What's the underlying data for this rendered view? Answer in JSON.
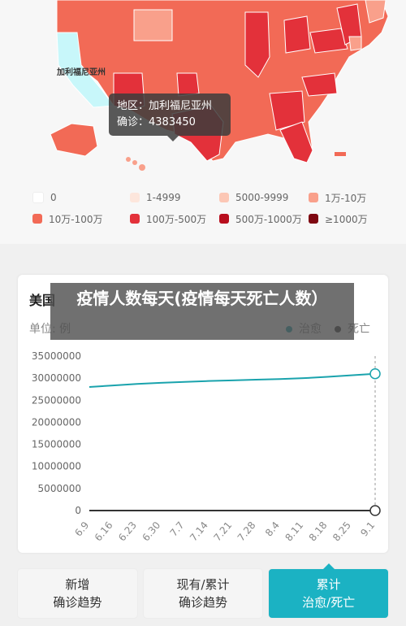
{
  "map": {
    "region_label": "加利福尼亚州",
    "tooltip": {
      "region_text": "地区：加利福尼亚州",
      "confirmed_text": "确诊：4383450"
    },
    "legend": [
      {
        "label": "0",
        "color": "#ffffff"
      },
      {
        "label": "1-4999",
        "color": "#fde6dc"
      },
      {
        "label": "5000-9999",
        "color": "#fcc7b5"
      },
      {
        "label": "1万-10万",
        "color": "#f9a08b"
      },
      {
        "label": "10万-100万",
        "color": "#f26a56"
      },
      {
        "label": "100万-500万",
        "color": "#e3313a"
      },
      {
        "label": "500万-1000万",
        "color": "#b80e1e"
      },
      {
        "label": "≥1000万",
        "color": "#7e0711"
      }
    ]
  },
  "chart_card": {
    "title": "美国",
    "unit": "单位: 例",
    "overlay_text": "疫情人数每天(疫情每天死亡人数）"
  },
  "chart_data": {
    "type": "line",
    "x": [
      "6.9",
      "6.16",
      "6.23",
      "6.30",
      "7.7",
      "7.14",
      "7.21",
      "7.28",
      "8.4",
      "8.11",
      "8.18",
      "8.25",
      "9.1"
    ],
    "series": [
      {
        "name": "治愈",
        "color": "#1aa3ad",
        "values": [
          28000000,
          28350000,
          28700000,
          28950000,
          29150000,
          29350000,
          29500000,
          29650000,
          29800000,
          30000000,
          30300000,
          30650000,
          31000000
        ]
      },
      {
        "name": "死亡",
        "color": "#333333",
        "values": [
          0,
          0,
          0,
          0,
          0,
          0,
          0,
          0,
          0,
          0,
          0,
          0,
          0
        ]
      }
    ],
    "yticks": [
      "35000000",
      "30000000",
      "25000000",
      "20000000",
      "15000000",
      "10000000",
      "5000000",
      "0"
    ],
    "ylim": [
      0,
      35000000
    ]
  },
  "tabs": [
    {
      "line1": "新增",
      "line2": "确诊趋势"
    },
    {
      "line1": "现有/累计",
      "line2": "确诊趋势"
    },
    {
      "line1": "累计",
      "line2": "治愈/死亡"
    }
  ]
}
